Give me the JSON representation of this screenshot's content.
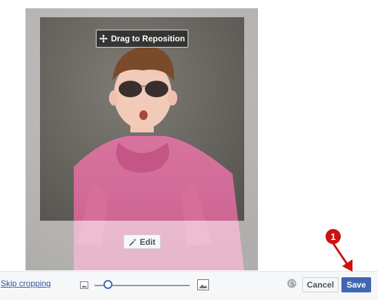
{
  "cropper": {
    "reposition_label": "Drag to Reposition",
    "edit_label": "Edit",
    "photo_subject": "boy-in-sunglasses-pink-shirt"
  },
  "footer": {
    "skip_cropping_label": "Skip cropping",
    "zoom_level": 0.14,
    "cancel_label": "Cancel",
    "save_label": "Save"
  },
  "annotation": {
    "step_number": "1"
  },
  "colors": {
    "accent": "#4267b2",
    "link": "#365899",
    "annotation": "#cc1111"
  }
}
